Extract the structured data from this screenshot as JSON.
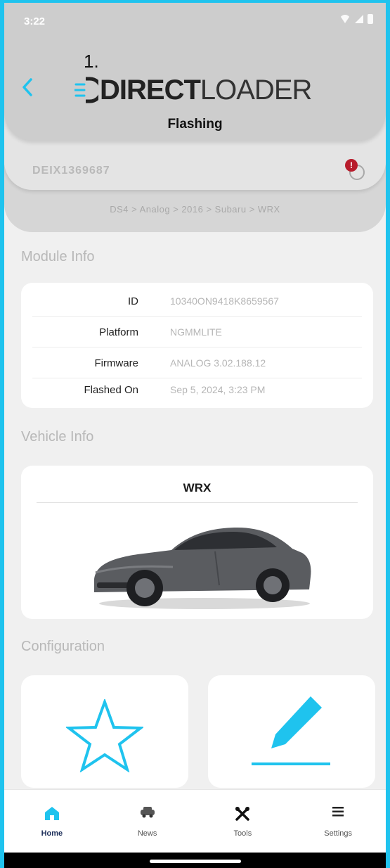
{
  "status_bar": {
    "time": "3:22"
  },
  "header": {
    "step_label": "1.",
    "logo_bold": "DIRECT",
    "logo_light": "LOADER",
    "title": "Flashing"
  },
  "device": {
    "id": "DEIX1369687",
    "status_badge": "!"
  },
  "breadcrumb": "DS4 > Analog > 2016 > Subaru > WRX",
  "module_info": {
    "title": "Module Info",
    "rows": [
      {
        "label": "ID",
        "value": "10340ON9418K8659567"
      },
      {
        "label": "Platform",
        "value": "NGMMLITE"
      },
      {
        "label": "Firmware",
        "value": "ANALOG 3.02.188.12"
      },
      {
        "label": "Flashed On",
        "value": "Sep 5, 2024, 3:23 PM"
      }
    ]
  },
  "vehicle_info": {
    "title": "Vehicle Info",
    "model": "WRX"
  },
  "configuration": {
    "title": "Configuration",
    "cards": [
      {
        "icon": "star-icon"
      },
      {
        "icon": "pencil-icon"
      }
    ]
  },
  "nav": {
    "items": [
      {
        "label": "Home",
        "icon": "home-icon",
        "active": true
      },
      {
        "label": "News",
        "icon": "news-icon"
      },
      {
        "label": "Tools",
        "icon": "tools-icon"
      },
      {
        "label": "Settings",
        "icon": "settings-icon"
      }
    ]
  },
  "colors": {
    "accent": "#1fc3ee",
    "header_bg": "#cdcdcd",
    "alert": "#b81c2c",
    "nav_active": "#1d2f5a"
  }
}
